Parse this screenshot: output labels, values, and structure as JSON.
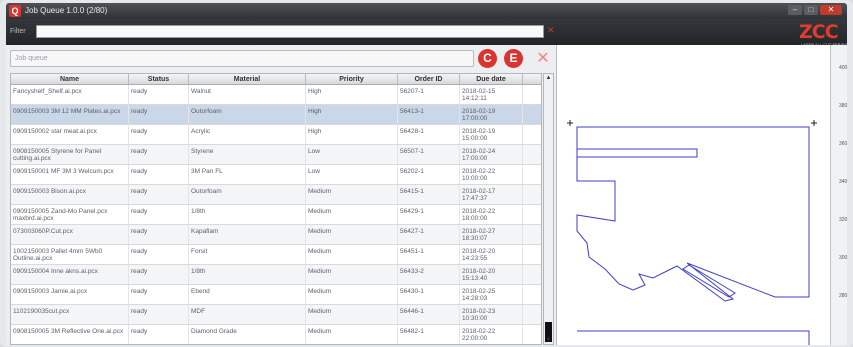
{
  "window": {
    "title": "Job Queue 1.0.0 (2/80)",
    "icon": "app-logo-icon",
    "minimize": "–",
    "maximize": "□",
    "close": "✕"
  },
  "filter": {
    "label": "Filter",
    "value": "",
    "clear_icon": "✕"
  },
  "logo": {
    "brand": "ZCC",
    "tagline": "LASER ALL CUT SERIES"
  },
  "search": {
    "placeholder": "Job queue"
  },
  "actions": {
    "c_label": "C",
    "e_label": "E",
    "x_label": "✕"
  },
  "columns": [
    "Name",
    "Status",
    "Material",
    "Priority",
    "Order ID",
    "Due date"
  ],
  "rows": [
    {
      "name": "Fancyshelf_Shelf.ai.pcx",
      "status": "ready",
      "material": "Walnut",
      "priority": "High",
      "order": "56207-1",
      "due": "2018-02-15 14:12:11"
    },
    {
      "name": "0909150003 3M 12 MM Plates.ai.pcx",
      "status": "ready",
      "material": "Outorfoam",
      "priority": "High",
      "order": "56413-1",
      "due": "2018-02-19 17:00:00"
    },
    {
      "name": "0909150002 star meat.ai.pcx",
      "status": "ready",
      "material": "Acrylic",
      "priority": "High",
      "order": "56428-1",
      "due": "2018-02-19 15:00:00"
    },
    {
      "name": "0908150005 Styrene for Panel cutting.ai.pcx",
      "status": "ready",
      "material": "Styrene",
      "priority": "Low",
      "order": "56507-1",
      "due": "2018-02-24 17:00:00"
    },
    {
      "name": "0909150001 MF 3M 3 Welcum.pcx",
      "status": "ready",
      "material": "3M Pan FL",
      "priority": "Low",
      "order": "56202-1",
      "due": "2018-02-22 10:00:00"
    },
    {
      "name": "0909150003 Bison.ai.pcx",
      "status": "ready",
      "material": "Outorfoam",
      "priority": "Medium",
      "order": "56415-1",
      "due": "2018-02-17 17:47:37"
    },
    {
      "name": "0909150005 Zand-Mo Panel.pcx maxbrd.ai.pcx",
      "status": "ready",
      "material": "1/8th",
      "priority": "Medium",
      "order": "56429-1",
      "due": "2018-02-22 18:00:00"
    },
    {
      "name": "073003060P.Cut.pcx",
      "status": "ready",
      "material": "Kapaflam",
      "priority": "Medium",
      "order": "56427-1",
      "due": "2018-02-27 18:30:07"
    },
    {
      "name": "1002150003 Pallet 4mm 5Wb0 Outline.ai.pcx",
      "status": "ready",
      "material": "Forsit",
      "priority": "Medium",
      "order": "56451-1",
      "due": "2018-02-20 14:23:55"
    },
    {
      "name": "0909150004 Inne akns.ai.pcx",
      "status": "ready",
      "material": "1/8th",
      "priority": "Medium",
      "order": "56433-2",
      "due": "2018-02-20 15:13:40"
    },
    {
      "name": "0909150003 Jamie.ai.pcx",
      "status": "ready",
      "material": "Ebend",
      "priority": "Medium",
      "order": "56430-1",
      "due": "2018-02-25 14:28:03"
    },
    {
      "name": "1102190035cut.pcx",
      "status": "ready",
      "material": "MDF",
      "priority": "Medium",
      "order": "56446-1",
      "due": "2018-02-23 10:30:00"
    },
    {
      "name": "0908150005 3M Reflective One.ai.pcx",
      "status": "ready",
      "material": "Diamond Grade",
      "priority": "Medium",
      "order": "56482-1",
      "due": "2018-02-22 22:00:00"
    }
  ],
  "selected_row": 1,
  "ruler": {
    "labels": [
      "400",
      "380",
      "360",
      "340",
      "320",
      "300",
      "280"
    ]
  },
  "colors": {
    "accent": "#d9342f",
    "shape_stroke": "#3d3fc4",
    "selection": "#c9d7e8"
  }
}
